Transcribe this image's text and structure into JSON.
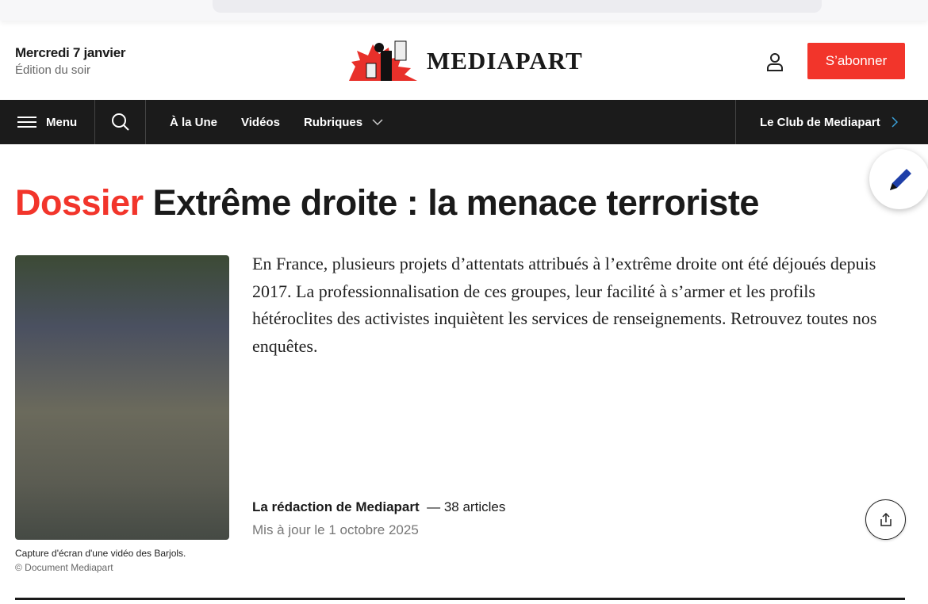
{
  "header": {
    "date": "Mercredi 7 janvier",
    "edition": "Édition du soir",
    "logo_text": "MEDIAPART",
    "subscribe_label": "S’abonner"
  },
  "nav": {
    "menu_label": "Menu",
    "links": [
      "À la Une",
      "Vidéos",
      "Rubriques"
    ],
    "club_label": "Le Club de Mediapart"
  },
  "dossier": {
    "kicker": "Dossier",
    "title": "Extrême droite : la menace terroriste",
    "intro": "En France, plusieurs projets d’attentats attribués à l’extrême droite ont été déjoués depuis 2017.  La professionnalisation de ces groupes, leur facilité à s’armer et les profils hétéroclites des activistes inquiètent les services de renseignements. Retrouvez toutes nos enquêtes.",
    "image_caption": "Capture d'écran d'une vidéo des Barjols.",
    "image_credit": "© Document Mediapart",
    "author": "La rédaction de Mediapart",
    "article_count": "— 38 articles",
    "updated": "Mis à jour le 1 octobre 2025"
  },
  "colors": {
    "accent": "#f2352b",
    "nav_bg": "#1b1b1b"
  }
}
